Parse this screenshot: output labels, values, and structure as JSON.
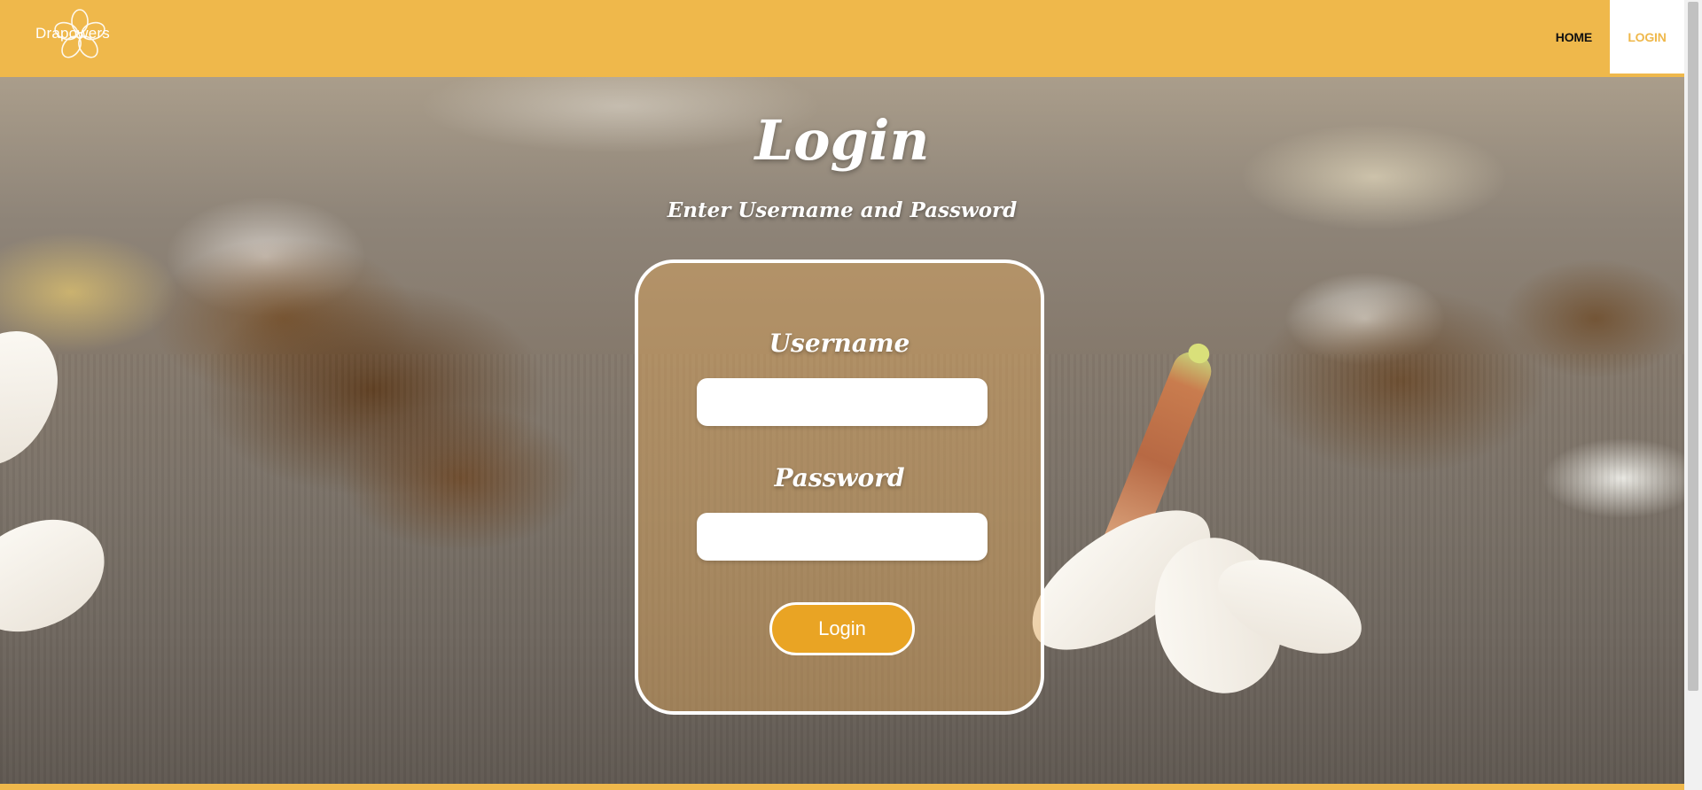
{
  "header": {
    "brand": "Drapowers",
    "nav": [
      {
        "label": "HOME",
        "active": false
      },
      {
        "label": "LOGIN",
        "active": true
      }
    ]
  },
  "main": {
    "title": "Login",
    "subtitle": "Enter Username and Password"
  },
  "form": {
    "username_label": "Username",
    "username_value": "",
    "password_label": "Password",
    "password_value": "",
    "submit_label": "Login"
  },
  "colors": {
    "accent": "#efb84b",
    "button": "#e9a424",
    "white": "#ffffff"
  },
  "icons": {
    "logo": "flower-logo-icon"
  }
}
